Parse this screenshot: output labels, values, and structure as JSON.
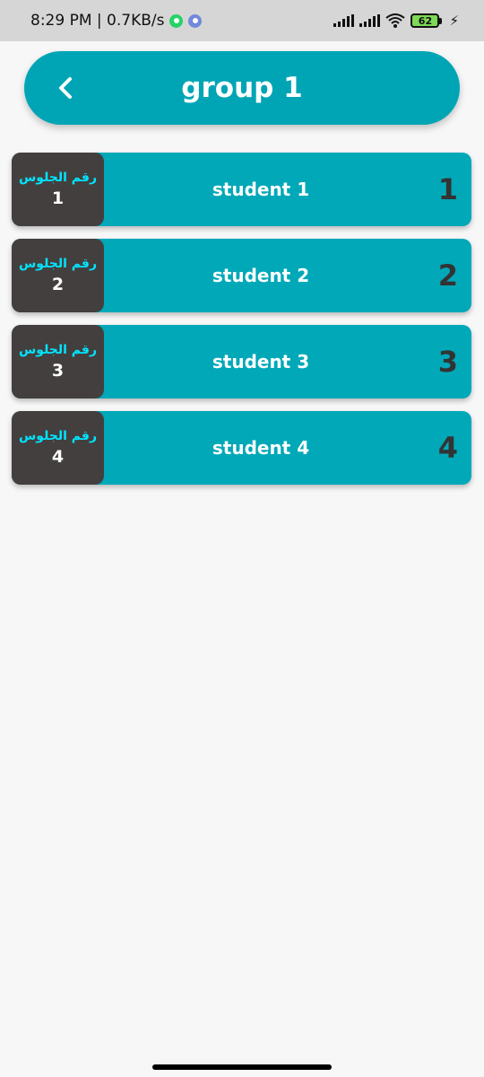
{
  "status_bar": {
    "time_speed": "8:29 PM | 0.7KB/s",
    "battery": "62",
    "icons": [
      "whatsapp-icon",
      "discord-icon",
      "signal-icon",
      "signal-icon",
      "wifi-icon",
      "battery-icon",
      "charging-icon"
    ]
  },
  "header": {
    "title": "group 1",
    "back_icon": "chevron-left-icon",
    "color": "#00a5b5"
  },
  "students": [
    {
      "seat_label": "رقم الجلوس",
      "seat_number": "1",
      "name": "student 1",
      "index": "1"
    },
    {
      "seat_label": "رقم الجلوس",
      "seat_number": "2",
      "name": "student 2",
      "index": "2"
    },
    {
      "seat_label": "رقم الجلوس",
      "seat_number": "3",
      "name": "student 3",
      "index": "3"
    },
    {
      "seat_label": "رقم الجلوس",
      "seat_number": "4",
      "name": "student 4",
      "index": "4"
    }
  ],
  "colors": {
    "card": "#00a8b8",
    "seat_box": "#433f3e",
    "seat_label": "#00e5ff",
    "index": "#333333"
  }
}
